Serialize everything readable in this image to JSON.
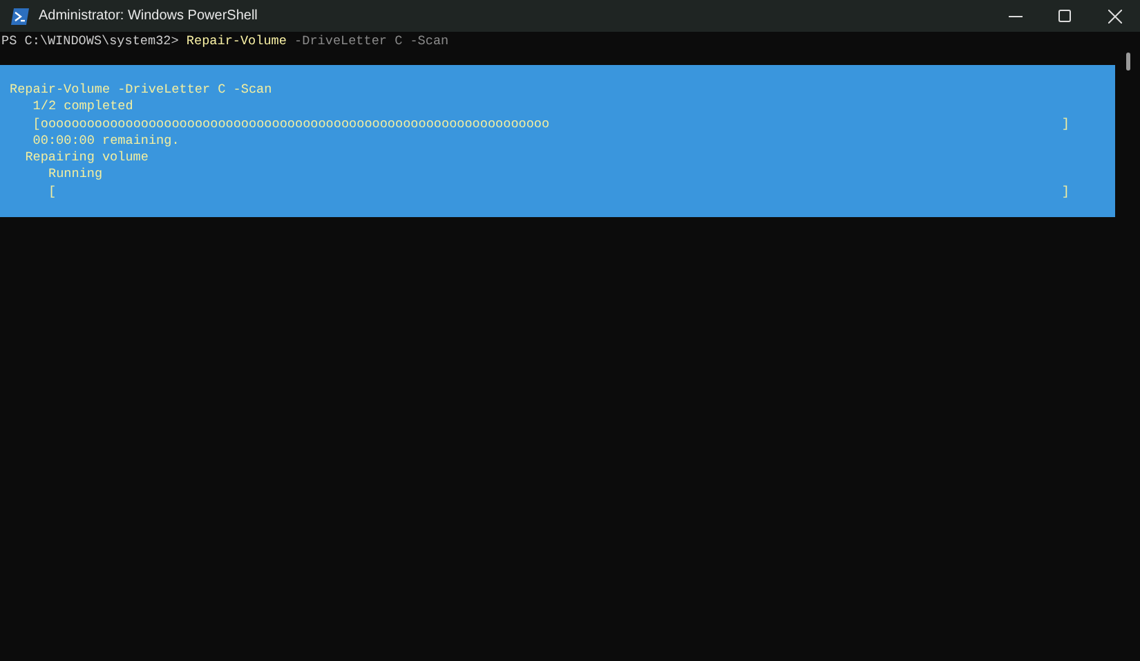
{
  "window": {
    "title": "Administrator: Windows PowerShell"
  },
  "prompt": {
    "path": "PS C:\\WINDOWS\\system32>",
    "command": "Repair-Volume",
    "args": "-DriveLetter C -Scan"
  },
  "progress": {
    "activity": "Repair-Volume -DriveLetter C -Scan",
    "lines": [
      {
        "kind": "text",
        "text": "1/2 completed"
      },
      {
        "kind": "bar",
        "text": "[oooooooooooooooooooooooooooooooooooooooooooooooooooooooooooooooooo",
        "end": "]"
      },
      {
        "kind": "text",
        "text": "00:00:00 remaining."
      }
    ],
    "children": [
      {
        "activity": "Repairing volume",
        "lines": [
          {
            "kind": "text",
            "text": "Running"
          },
          {
            "kind": "bar",
            "text": "[",
            "end": "]"
          }
        ]
      }
    ]
  }
}
